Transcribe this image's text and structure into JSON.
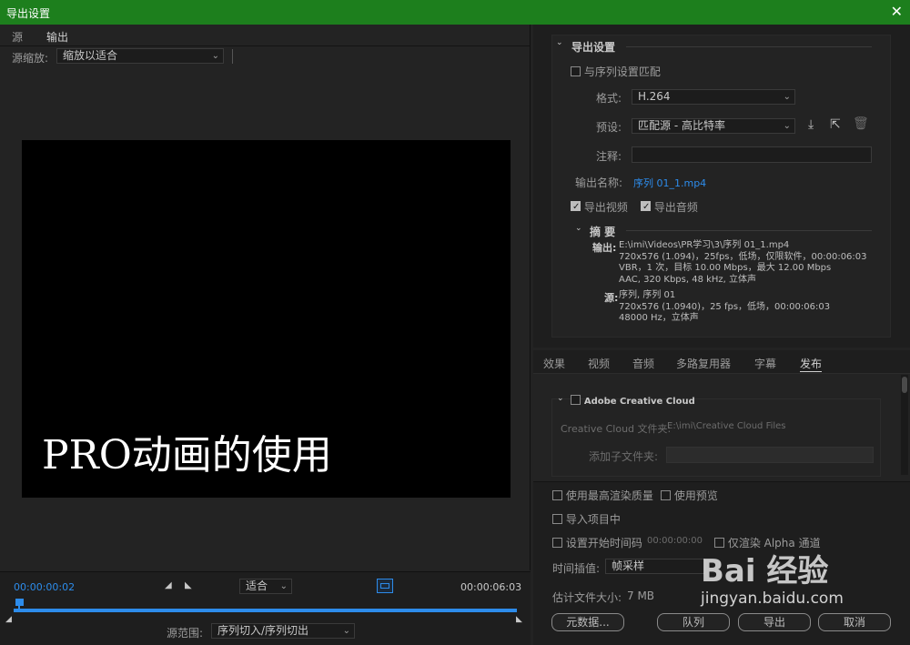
{
  "window": {
    "title": "导出设置",
    "close_icon": "close-icon"
  },
  "left_panel": {
    "tabs": [
      {
        "label": "源"
      },
      {
        "label": "输出"
      }
    ],
    "source_scale": {
      "label": "源缩放:",
      "value": "缩放以适合"
    },
    "preview_text": "PRO动画的使用",
    "timeline": {
      "current_time": "00:00:00:02",
      "duration": "00:00:06:03",
      "fit_value": "适合",
      "playhead_progress": 0.01,
      "source_range_label": "源范围:",
      "source_range_value": "序列切入/序列切出"
    }
  },
  "export_settings": {
    "header": "导出设置",
    "match_sequence": "与序列设置匹配",
    "format_label": "格式:",
    "format_value": "H.264",
    "preset_label": "预设:",
    "preset_value": "匹配源 - 高比特率",
    "comments_label": "注释:",
    "comments_value": "",
    "output_name_label": "输出名称:",
    "output_name_value": "序列 01_1.mp4",
    "export_video": "导出视频",
    "export_audio": "导出音频",
    "summary_header": "摘 要",
    "summary_output_label": "输出:",
    "summary_output_lines": [
      "E:\\imi\\Videos\\PR学习\\3\\序列 01_1.mp4",
      "720x576 (1.094)，25fps，低场，仅限软件，00:00:06:03",
      "VBR，1 次，目标 10.00 Mbps，最大 12.00 Mbps",
      "AAC, 320 Kbps, 48  kHz, 立体声"
    ],
    "summary_source_label": "源:",
    "summary_source_lines": [
      "序列, 序列 01",
      "720x576 (1.0940)，25 fps，低场，00:00:06:03",
      "48000 Hz，立体声"
    ]
  },
  "settings_tabs": [
    {
      "label": "效果"
    },
    {
      "label": "视频"
    },
    {
      "label": "音频"
    },
    {
      "label": "多路复用器"
    },
    {
      "label": "字幕"
    },
    {
      "label": "发布"
    }
  ],
  "publish": {
    "section": "Adobe Creative Cloud",
    "cc_folder_label": "Creative Cloud 文件夹:",
    "cc_folder_value": "E:\\imi\\Creative Cloud Files",
    "subfolder_label": "添加子文件夹:"
  },
  "bottom": {
    "max_render_quality": "使用最高渲染质量",
    "use_previews": "使用预览",
    "import_into_project": "导入项目中",
    "set_start_timecode": "设置开始时间码",
    "start_timecode_value": "00:00:00:00",
    "render_alpha_only": "仅渲染 Alpha 通道",
    "time_interpolation_label": "时间插值:",
    "time_interpolation_value": "帧采样",
    "estimated_size_label": "估计文件大小:",
    "estimated_size_value": "7 MB",
    "metadata_button": "元数据...",
    "queue_button": "队列",
    "export_button": "导出",
    "cancel_button": "取消"
  },
  "watermark": {
    "brand": "Bai 经验",
    "url": "jingyan.baidu.com"
  },
  "colors": {
    "title_bar": "#1d7f1d",
    "accent_blue": "#2d8ceb",
    "panel_bg": "#232323"
  }
}
